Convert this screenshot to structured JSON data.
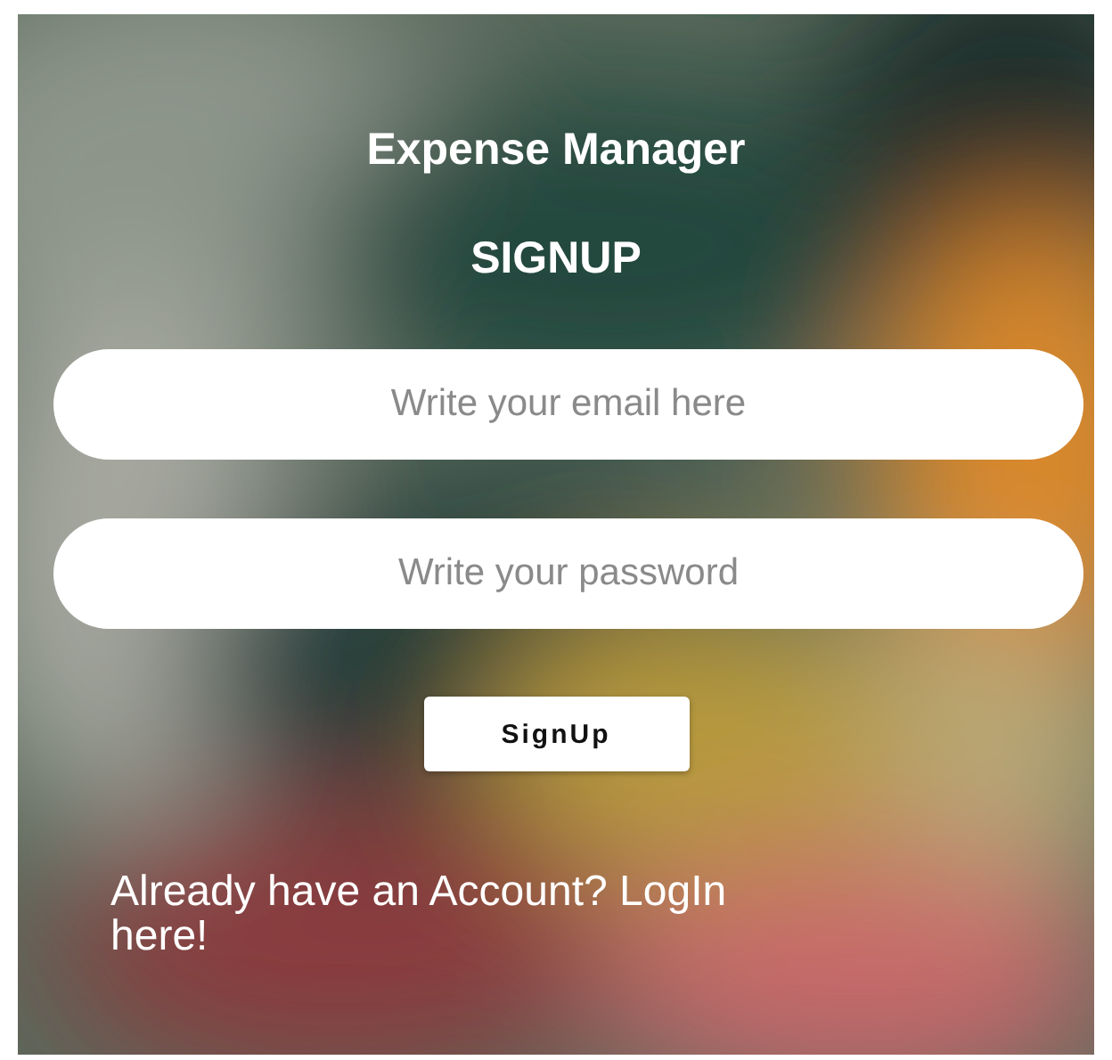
{
  "app": {
    "title": "Expense Manager",
    "heading": "SIGNUP"
  },
  "fields": [
    {
      "placeholder": "Write your email here"
    },
    {
      "placeholder": "Write your password"
    }
  ],
  "button": {
    "label": "SignUp"
  },
  "footer_link": "Already have an Account? LogIn here!"
}
